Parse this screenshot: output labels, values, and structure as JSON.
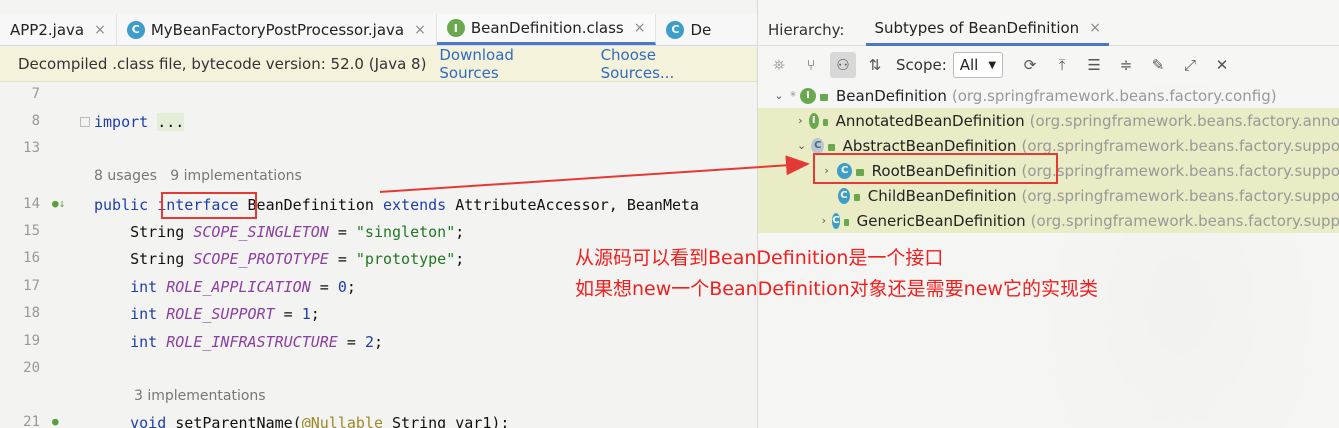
{
  "editor": {
    "tabs": [
      {
        "label": "APP2.java",
        "icon": "none",
        "active": false
      },
      {
        "label": "MyBeanFactoryPostProcessor.java",
        "icon": "class-icon",
        "active": false
      },
      {
        "label": "BeanDefinition.class",
        "icon": "interface-icon",
        "active": true
      },
      {
        "label": "De",
        "icon": "class-icon",
        "active": false
      }
    ],
    "infobar": {
      "message": "Decompiled .class file, bytecode version: 52.0 (Java 8)",
      "download": "Download Sources",
      "choose": "Choose Sources..."
    },
    "lines": [
      {
        "num": "7",
        "text": ""
      },
      {
        "num": "8",
        "text": "import ..."
      },
      {
        "num": "13",
        "text": ""
      },
      {
        "num": "",
        "hint": "8 usages   9 implementations"
      },
      {
        "num": "14",
        "text": "public interface BeanDefinition extends AttributeAccessor, BeanMeta"
      },
      {
        "num": "15",
        "text": "    String SCOPE_SINGLETON = \"singleton\";"
      },
      {
        "num": "16",
        "text": "    String SCOPE_PROTOTYPE = \"prototype\";"
      },
      {
        "num": "17",
        "text": "    int ROLE_APPLICATION = 0;"
      },
      {
        "num": "18",
        "text": "    int ROLE_SUPPORT = 1;"
      },
      {
        "num": "19",
        "text": "    int ROLE_INFRASTRUCTURE = 2;"
      },
      {
        "num": "20",
        "text": ""
      },
      {
        "num": "",
        "hint": "3 implementations"
      },
      {
        "num": "21",
        "text": "    void setParentName(@Nullable String var1);"
      }
    ]
  },
  "hierarchy": {
    "title": "Hierarchy:",
    "tab": "Subtypes of BeanDefinition",
    "scope_label": "Scope:",
    "scope_value": "All",
    "nodes": [
      {
        "name": "BeanDefinition",
        "pkg": "(org.springframework.beans.factory.config)",
        "icon": "I"
      },
      {
        "name": "AnnotatedBeanDefinition",
        "pkg": "(org.springframework.beans.factory.anno",
        "icon": "I"
      },
      {
        "name": "AbstractBeanDefinition",
        "pkg": "(org.springframework.beans.factory.suppo",
        "icon": "C"
      },
      {
        "name": "RootBeanDefinition",
        "pkg": "(org.springframework.beans.factory.suppo",
        "icon": "C"
      },
      {
        "name": "ChildBeanDefinition",
        "pkg": "(org.springframework.beans.factory.suppo",
        "icon": "C"
      },
      {
        "name": "GenericBeanDefinition",
        "pkg": "(org.springframework.beans.factory.supp",
        "icon": "C"
      }
    ]
  },
  "annotation": {
    "line1": "从源码可以看到BeanDefinition是一个接口",
    "line2": "如果想new一个BeanDefinition对象还是需要new它的实现类",
    "color": "#f02020"
  }
}
